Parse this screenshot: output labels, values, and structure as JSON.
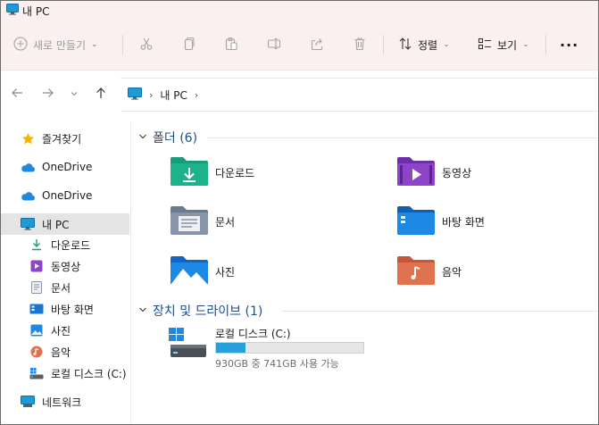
{
  "window": {
    "title": "내 PC"
  },
  "toolbar": {
    "new_label": "새로 만들기",
    "sort_label": "정렬",
    "view_label": "보기",
    "more_label": "···"
  },
  "address": {
    "crumb": "내 PC"
  },
  "sidebar": {
    "quick_access": "즐겨찾기",
    "onedrive_1": "OneDrive",
    "onedrive_2": "OneDrive",
    "this_pc": "내 PC",
    "items": [
      {
        "label": "다운로드",
        "icon": "download-icon"
      },
      {
        "label": "동영상",
        "icon": "video-icon"
      },
      {
        "label": "문서",
        "icon": "document-icon"
      },
      {
        "label": "바탕 화면",
        "icon": "desktop-icon"
      },
      {
        "label": "사진",
        "icon": "pictures-icon"
      },
      {
        "label": "음악",
        "icon": "music-icon"
      },
      {
        "label": "로컬 디스크 (C:)",
        "icon": "drive-icon"
      }
    ],
    "network": "네트워크"
  },
  "main": {
    "folders_header": "폴더 (6)",
    "folders": [
      {
        "label": "다운로드",
        "icon": "download-folder-icon"
      },
      {
        "label": "동영상",
        "icon": "video-folder-icon"
      },
      {
        "label": "문서",
        "icon": "document-folder-icon"
      },
      {
        "label": "바탕 화면",
        "icon": "desktop-folder-icon"
      },
      {
        "label": "사진",
        "icon": "pictures-folder-icon"
      },
      {
        "label": "음악",
        "icon": "music-folder-icon"
      }
    ],
    "drives_header": "장치 및 드라이브 (1)",
    "drive": {
      "name": "로컬 디스크 (C:)",
      "info": "930GB 중 741GB 사용 가능",
      "used_fraction": 0.2
    }
  },
  "colors": {
    "chrome_bg": "#f9f0ef",
    "accent": "#26a0da",
    "group_header": "#1f4e8c",
    "selected_bg": "#e4e4e4"
  }
}
